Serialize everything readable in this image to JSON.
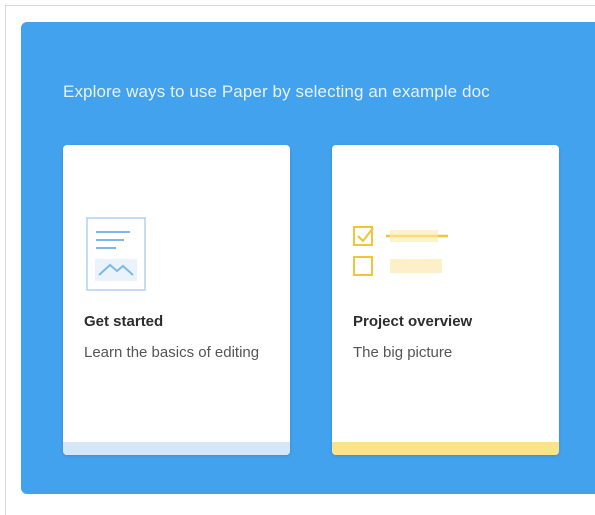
{
  "banner": {
    "heading": "Explore ways to use Paper by selecting an example doc",
    "background_color": "#42a2ee"
  },
  "cards": [
    {
      "title": "Get started",
      "description": "Learn the basics of editing",
      "icon": "document-image-icon",
      "footer_color": "#d4e6f7"
    },
    {
      "title": "Project overview",
      "description": "The big picture",
      "icon": "checklist-icon",
      "footer_color": "#fbe28c"
    }
  ]
}
